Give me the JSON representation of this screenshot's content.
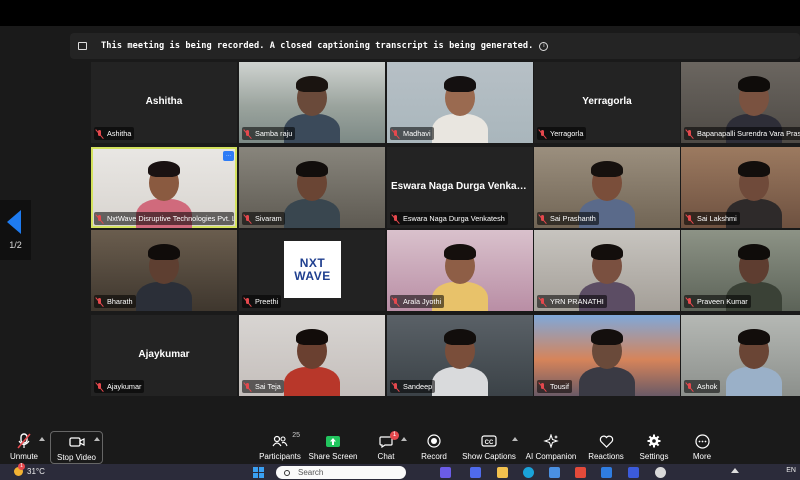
{
  "banner": {
    "message": "This meeting is being recorded. A closed captioning transcript is being generated.",
    "info_icon": "info-icon"
  },
  "pager": {
    "page": "1/2"
  },
  "tiles": [
    {
      "name": "Ashitha",
      "label": "Ashitha",
      "video": false
    },
    {
      "name": "Samba raju",
      "label": "Samba raju",
      "video": true
    },
    {
      "name": "Madhavi",
      "label": "Madhavi",
      "video": true
    },
    {
      "name": "Yerragorla",
      "label": "Yerragorla",
      "video": false
    },
    {
      "name": "Bapanapalli Surendra Vara Prasad",
      "label": "Bapanapalli Surendra Vara Prasa",
      "video": true
    },
    {
      "name": "NxtWave Disruptive Technologies Pvt. Ltd.",
      "label": "NxtWave Disruptive Technologies Pvt. Ltd.",
      "video": true,
      "active": true
    },
    {
      "name": "Sivaram",
      "label": "Sivaram",
      "video": true
    },
    {
      "name": "Eswara Naga Durga Venkatesh",
      "display": "Eswara Naga Durga Venkate...",
      "label": "Eswara Naga Durga Venkatesh",
      "video": false
    },
    {
      "name": "Sai Prashanth",
      "label": "Sai Prashanth",
      "video": true
    },
    {
      "name": "Sai Lakshmi",
      "label": "Sai Lakshmi",
      "video": true
    },
    {
      "name": "Bharath",
      "label": "Bharath",
      "video": true
    },
    {
      "name": "Preethi",
      "label": "Preethi",
      "video": true,
      "logo": [
        "NXT",
        "WAVE"
      ]
    },
    {
      "name": "Arala Jyothi",
      "label": "Arala Jyothi",
      "video": true
    },
    {
      "name": "YRN PRANATHI",
      "label": "YRN PRANATHI",
      "video": true
    },
    {
      "name": "Praveen Kumar",
      "label": "Praveen Kumar",
      "video": true
    },
    {
      "name": "Ajaykumar",
      "label": "Ajaykumar",
      "video": false
    },
    {
      "name": "Sai Teja",
      "label": "Sai Teja",
      "video": true
    },
    {
      "name": "Sandeep",
      "label": "Sandeep",
      "video": true
    },
    {
      "name": "Tousif",
      "label": "Tousif",
      "video": true
    },
    {
      "name": "Ashok",
      "label": "Ashok",
      "video": true
    }
  ],
  "toolbar": {
    "unmute": "Unmute",
    "stop_video": "Stop Video",
    "participants": "Participants",
    "participants_count": "25",
    "share_screen": "Share Screen",
    "chat": "Chat",
    "chat_badge": "1",
    "record": "Record",
    "show_captions": "Show Captions",
    "ai_companion": "AI Companion",
    "reactions": "Reactions",
    "settings": "Settings",
    "more": "More"
  },
  "taskbar": {
    "temperature": "31°C",
    "weather_badge": "1",
    "search_placeholder": "Search",
    "language": "EN"
  },
  "colors": {
    "accent_blue": "#1e7bf0",
    "active_speaker": "#d4e25e",
    "muted_red": "#e5484d",
    "share_green": "#22c55e"
  }
}
